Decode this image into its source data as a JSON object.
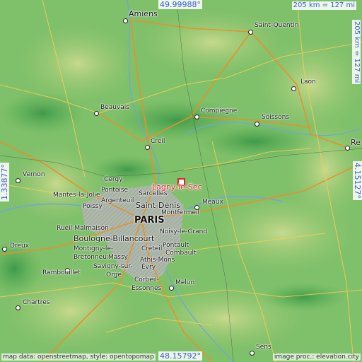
{
  "coords": {
    "top_lat": "49.99988°",
    "bottom_lat": "48.15792°",
    "left_lon": "1.33877°",
    "right_lon": "4.15127°"
  },
  "scale": {
    "horizontal": "205 km = 127 mi",
    "vertical": "205 km = 127 mi"
  },
  "target": {
    "label": "Lagny-le-Sec"
  },
  "cities": [
    {
      "id": "amiens",
      "label": "Amiens"
    },
    {
      "id": "saint-quentin",
      "label": "Saint-Quentin"
    },
    {
      "id": "laon",
      "label": "Laon"
    },
    {
      "id": "beauvais",
      "label": "Beauvais"
    },
    {
      "id": "compiegne",
      "label": "Compiègne"
    },
    {
      "id": "soissons",
      "label": "Soissons"
    },
    {
      "id": "reims",
      "label": "Re"
    },
    {
      "id": "creil",
      "label": "Creil"
    },
    {
      "id": "vernon",
      "label": "Vernon"
    },
    {
      "id": "cergy",
      "label": "Cergy"
    },
    {
      "id": "pontoise",
      "label": "Pontoise"
    },
    {
      "id": "mantes",
      "label": "Mantes-la-Jolie"
    },
    {
      "id": "sarcelles",
      "label": "Sarcelles"
    },
    {
      "id": "argenteuil",
      "label": "Argenteuil"
    },
    {
      "id": "poissy",
      "label": "Poissy"
    },
    {
      "id": "saint-denis",
      "label": "Saint-Denis"
    },
    {
      "id": "montfermeil",
      "label": "Montfermeil"
    },
    {
      "id": "meaux",
      "label": "Meaux"
    },
    {
      "id": "paris",
      "label": "PARIS"
    },
    {
      "id": "rueil",
      "label": "Rueil-Malmaison"
    },
    {
      "id": "boulogne",
      "label": "Boulogne-Billancourt"
    },
    {
      "id": "noisy",
      "label": "Noisy-le-Grand"
    },
    {
      "id": "dreux",
      "label": "Dreux"
    },
    {
      "id": "montigny",
      "label": "Montigny-le-"
    },
    {
      "id": "bretonneux",
      "label": "Bretonneux"
    },
    {
      "id": "creteil",
      "label": "Créteil"
    },
    {
      "id": "pontault",
      "label": "Pontault-"
    },
    {
      "id": "combault",
      "label": "Combault"
    },
    {
      "id": "massy",
      "label": "Massy"
    },
    {
      "id": "athis",
      "label": "Athis-Mons"
    },
    {
      "id": "savigny",
      "label": "Savigny-sur-"
    },
    {
      "id": "orge",
      "label": "Orge"
    },
    {
      "id": "evry",
      "label": "Évry"
    },
    {
      "id": "rambouillet",
      "label": "Rambouillet"
    },
    {
      "id": "corbeil",
      "label": "Corbeil-"
    },
    {
      "id": "essonnes",
      "label": "Essonnes"
    },
    {
      "id": "melun",
      "label": "Melun"
    },
    {
      "id": "chartres",
      "label": "Chartres"
    },
    {
      "id": "sens",
      "label": "Sens"
    }
  ],
  "footer": {
    "left": "map data: openstreetmap, style: opentopomap",
    "right": "image proc.: elevation.city"
  },
  "colors": {
    "lowland": "#7fc06a",
    "highland": "#a9cf7a",
    "urban": "#b0b0b0",
    "road_primary": "#f0a030",
    "road_secondary": "#f5d060",
    "coord_text": "#3d5bd6",
    "target": "#e32222"
  }
}
